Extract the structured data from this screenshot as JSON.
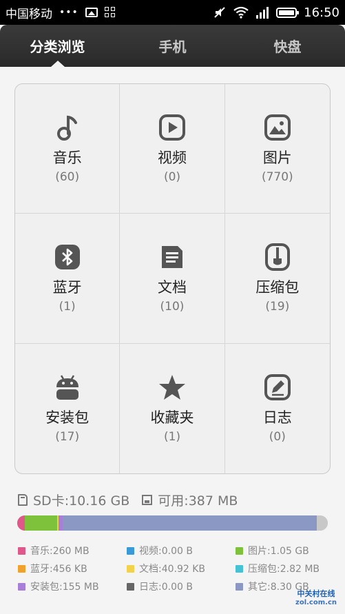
{
  "status_bar": {
    "carrier": "中国移动",
    "dots": "•••",
    "time": "16:50"
  },
  "tabs": [
    {
      "label": "分类浏览",
      "active": true
    },
    {
      "label": "手机",
      "active": false
    },
    {
      "label": "快盘",
      "active": false
    }
  ],
  "categories": [
    {
      "label": "音乐",
      "count": "(60)",
      "icon": "music-note-icon"
    },
    {
      "label": "视频",
      "count": "(0)",
      "icon": "video-play-icon"
    },
    {
      "label": "图片",
      "count": "(770)",
      "icon": "image-icon"
    },
    {
      "label": "蓝牙",
      "count": "(1)",
      "icon": "bluetooth-icon"
    },
    {
      "label": "文档",
      "count": "(10)",
      "icon": "document-icon"
    },
    {
      "label": "压缩包",
      "count": "(19)",
      "icon": "archive-icon"
    },
    {
      "label": "安装包",
      "count": "(17)",
      "icon": "android-icon"
    },
    {
      "label": "收藏夹",
      "count": "(1)",
      "icon": "star-icon"
    },
    {
      "label": "日志",
      "count": "(0)",
      "icon": "log-edit-icon"
    }
  ],
  "storage": {
    "sd_label": "SD卡:10.16 GB",
    "free_label": "可用:387 MB",
    "segments": [
      {
        "color": "#e0578a",
        "fraction": 0.025
      },
      {
        "color": "#3a9ad9",
        "fraction": 0.0
      },
      {
        "color": "#7dc23a",
        "fraction": 0.103
      },
      {
        "color": "#f0a22c",
        "fraction": 0.0
      },
      {
        "color": "#f1d24a",
        "fraction": 0.004
      },
      {
        "color": "#45c3d6",
        "fraction": 0.0
      },
      {
        "color": "#a77fd8",
        "fraction": 0.015
      },
      {
        "color": "#666666",
        "fraction": 0.0
      },
      {
        "color": "#8c98c4",
        "fraction": 0.817
      },
      {
        "color": "#c8c8c8",
        "fraction": 0.036
      }
    ]
  },
  "legend": [
    {
      "label": "音乐:260 MB",
      "color": "#e0578a"
    },
    {
      "label": "视频:0.00 B",
      "color": "#3a9ad9"
    },
    {
      "label": "图片:1.05 GB",
      "color": "#7dc23a"
    },
    {
      "label": "蓝牙:456 KB",
      "color": "#f0a22c"
    },
    {
      "label": "文档:40.92 KB",
      "color": "#f1d24a"
    },
    {
      "label": "压缩包:2.82 MB",
      "color": "#45c3d6"
    },
    {
      "label": "安装包:155 MB",
      "color": "#a77fd8"
    },
    {
      "label": "日志:0.00 B",
      "color": "#666666"
    },
    {
      "label": "其它:8.30 GB",
      "color": "#8c98c4"
    }
  ],
  "watermark": {
    "line1": "中关村在线",
    "line2": "zol.com.cn"
  }
}
